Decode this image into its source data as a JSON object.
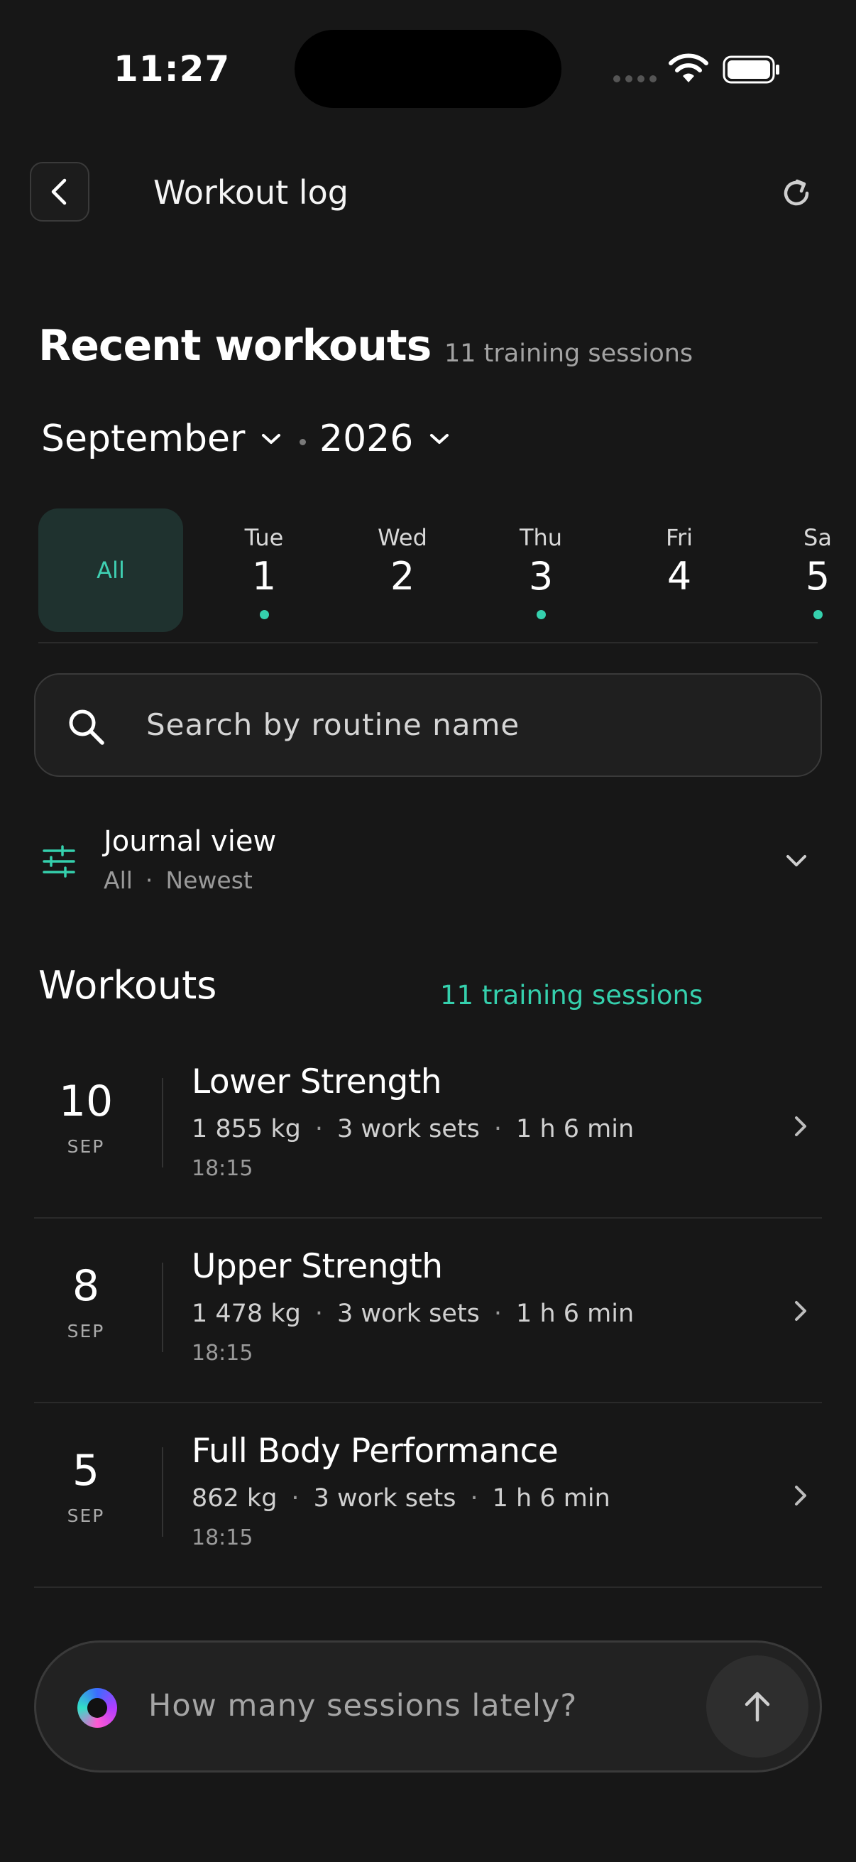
{
  "status_bar": {
    "time": "11:27"
  },
  "header": {
    "title": "Workout log"
  },
  "recent": {
    "title": "Recent workouts",
    "count": "11 training sessions"
  },
  "filters": {
    "month": "September",
    "year": "2026"
  },
  "day_strip": {
    "all_label": "All",
    "days": [
      {
        "name": "Tue",
        "date": "1",
        "has_workout": true
      },
      {
        "name": "Wed",
        "date": "2",
        "has_workout": false
      },
      {
        "name": "Thu",
        "date": "3",
        "has_workout": true
      },
      {
        "name": "Fri",
        "date": "4",
        "has_workout": false
      },
      {
        "name": "Sa",
        "date": "5",
        "has_workout": true
      }
    ]
  },
  "search": {
    "placeholder": "Search by routine name"
  },
  "journal": {
    "title": "Journal view",
    "filter": "All",
    "sort": "Newest",
    "separator": "·"
  },
  "workouts": {
    "title": "Workouts",
    "count": "11 training sessions",
    "items": [
      {
        "day": "10",
        "month": "SEP",
        "name": "Lower Strength",
        "volume": "1 855 kg",
        "sets": "3 work sets",
        "duration": "1 h 6 min",
        "time": "18:15"
      },
      {
        "day": "8",
        "month": "SEP",
        "name": "Upper Strength",
        "volume": "1 478 kg",
        "sets": "3 work sets",
        "duration": "1 h 6 min",
        "time": "18:15"
      },
      {
        "day": "5",
        "month": "SEP",
        "name": "Full Body Performance",
        "volume": "862 kg",
        "sets": "3 work sets",
        "duration": "1 h 6 min",
        "time": "18:15"
      }
    ]
  },
  "composer": {
    "placeholder": "How many sessions lately?"
  },
  "colors": {
    "accent": "#35d0ad",
    "background": "#171717",
    "chip_bg": "#1f322f"
  }
}
